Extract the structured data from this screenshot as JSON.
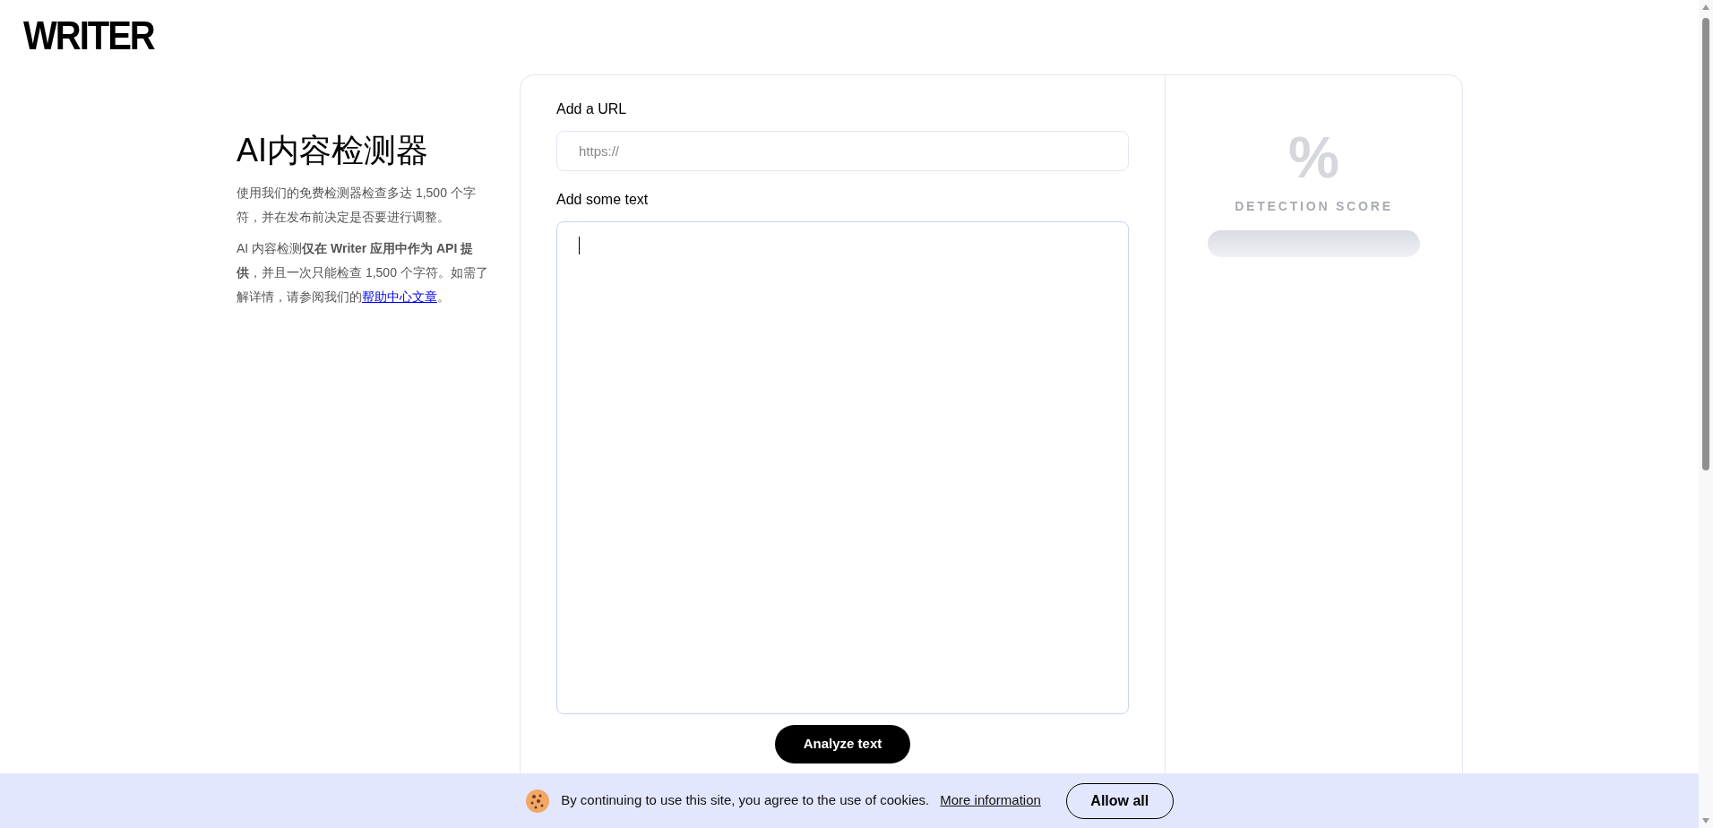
{
  "logo": "WRITER",
  "intro": {
    "title": "AI内容检测器",
    "paragraph": "使用我们的免费检测器检查多达 1,500 个字符，并在发布前决定是否要进行调整。",
    "note": {
      "text": "AI 内容检测**仅在 Writer 应用中作为 API 提供**，并且一次只能检查 1,500 个字符。如需了解详情，请参阅我们的",
      "link": "帮助中心文章",
      "after": "。"
    }
  },
  "form": {
    "url_label": "Add a URL",
    "url_placeholder": "https://",
    "text_label": "Add some text",
    "submit": "Analyze text"
  },
  "score": {
    "symbol": "%",
    "label": "DETECTION SCORE"
  },
  "cookie_bar": {
    "message": "By continuing to use this site, you agree to the use of cookies.",
    "link": "More information",
    "button": "Allow all"
  }
}
